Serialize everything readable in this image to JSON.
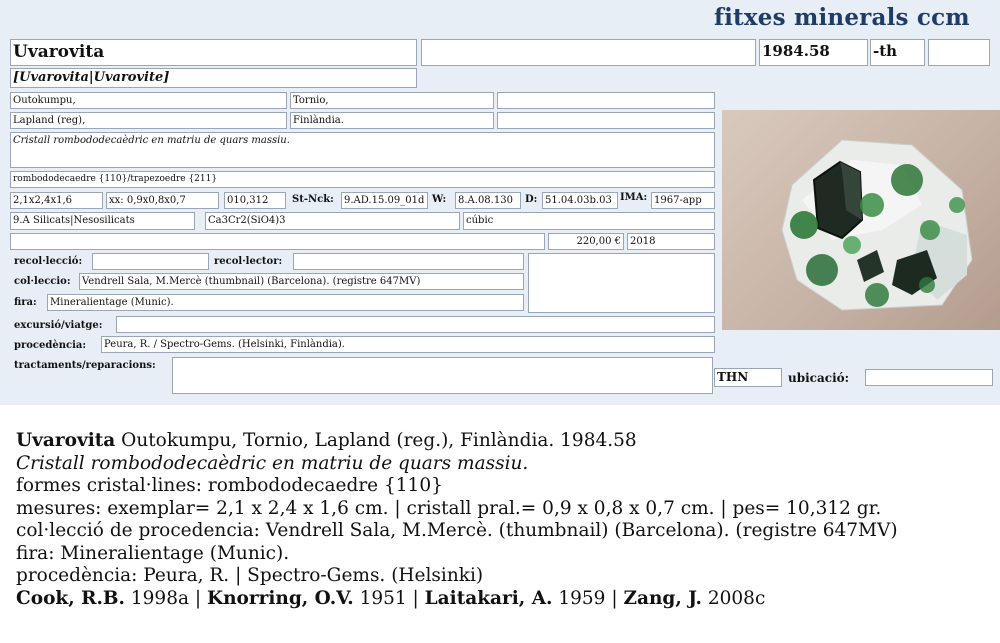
{
  "header": {
    "title": "fitxes minerals ccm"
  },
  "card": {
    "name": "Uvarovita",
    "synonyms": "[Uvarovita|Uvarovite]",
    "catalog_number": "1984.58",
    "suffix": "-th",
    "locality": [
      "Outokumpu,",
      "Tornio,",
      "Lapland (reg),",
      "Finlàndia."
    ],
    "description": "Cristall rombododecaèdric en matriu de quars massiu.",
    "forms": "rombododecaedre {110}/trapezoedre {211}",
    "dims_specimen": "2,1x2,4x1,6",
    "dims_crystal": "xx: 0,9x0,8x0,7",
    "weight": "010,312",
    "stnck_label": "St-Nck:",
    "stnck_value": "9.AD.15.09_01d",
    "w_label": "W:",
    "w_value": "8.A.08.130",
    "d_label": "D:",
    "d_value": "51.04.03b.03",
    "ima_label": "IMA:",
    "ima_value": "1967-app",
    "class": "9.A Silicats|Nesosilicats",
    "formula": "Ca3Cr2(SiO4)3",
    "system": "cúbic",
    "price": "220,00 €",
    "year": "2018",
    "recoleccio_label": "recol·lecció:",
    "recolector_label": "recol·lector:",
    "colleccio_label": "col·leccio:",
    "colleccio_value": "Vendrell Sala, M.Mercè (thumbnail) (Barcelona). (registre 647MV)",
    "fira_label": "fira:",
    "fira_value": "Mineralientage (Munic).",
    "excursio_label": "excursió/viatge:",
    "procedencia_label": "procedència:",
    "procedencia_value": "Peura, R. / Spectro-Gems. (Helsinki, Finlàndia).",
    "tractaments_label": "tractaments/reparacions:",
    "thn": "THN",
    "ubicacio_label": "ubicació:"
  },
  "summary": {
    "name": "Uvarovita",
    "locality": " Outokumpu, Tornio, Lapland (reg.), Finlàndia. 1984.58",
    "description": "Cristall rombododecaèdric en matriu de quars massiu.",
    "forms": "formes cristal·lines: rombododecaedre {110}",
    "measures": "mesures: exemplar= 2,1 x 2,4 x 1,6 cm. | cristall pral.= 0,9 x 0,8 x 0,7 cm. | pes= 10,312 gr.",
    "collection": "col·lecció de procedencia: Vendrell Sala, M.Mercè. (thumbnail) (Barcelona). (registre 647MV)",
    "fair": "fira: Mineralientage (Munic).",
    "origin": "procedència: Peura, R. | Spectro-Gems. (Helsinki)",
    "refs": [
      {
        "author": "Cook, R.B.",
        "year": " 1998a | "
      },
      {
        "author": "Knorring, O.V.",
        "year": " 1951 | "
      },
      {
        "author": "Laitakari, A.",
        "year": " 1959 | "
      },
      {
        "author": "Zang, J.",
        "year": " 2008c"
      }
    ]
  }
}
